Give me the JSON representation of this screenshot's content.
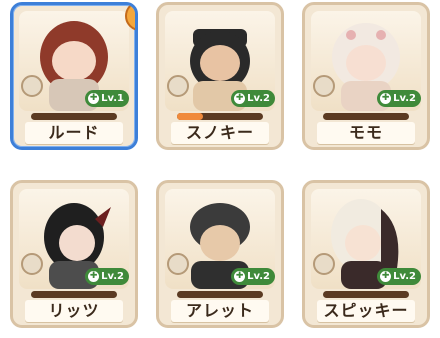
{
  "cards": [
    {
      "name": "ルード",
      "level": "Lv.1",
      "selected": true,
      "hair": "#8f3a2a",
      "skin": "#f6d9c7",
      "exp": 0.0
    },
    {
      "name": "スノキー",
      "level": "Lv.2",
      "selected": false,
      "hair": "#2a2a2a",
      "skin": "#e8c3a3",
      "exp": 0.3
    },
    {
      "name": "モモ",
      "level": "Lv.2",
      "selected": false,
      "hair": "#f2e9e1",
      "skin": "#f7dfd2",
      "exp": 0.0
    },
    {
      "name": "リッツ",
      "level": "Lv.2",
      "selected": false,
      "hair": "#1f1f1f",
      "skin": "#f3dccf",
      "exp": 0.0
    },
    {
      "name": "アレット",
      "level": "Lv.2",
      "selected": false,
      "hair": "#3b3b3b",
      "skin": "#e7c9a9",
      "exp": 0.0
    },
    {
      "name": "スピッキー",
      "level": "Lv.2",
      "selected": false,
      "hair": "#f1ebe0",
      "skin": "#f7e2d3",
      "exp": 0.0
    }
  ]
}
